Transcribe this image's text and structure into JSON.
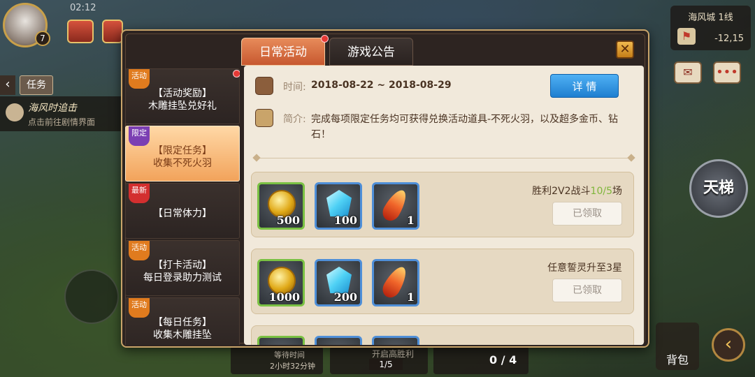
{
  "hud": {
    "level": "7",
    "status_time": "02:12",
    "task_tab": "任务",
    "task_title": "海风时追击",
    "task_hint": "点击前往剧情界面",
    "city_name": "海风城 1线",
    "coords": "-12,15",
    "ladder_label": "天梯",
    "bag_label": "背包",
    "wait_label": "等待时间",
    "wait_value": "2小时32分钟",
    "victory_label": "开启高胜利",
    "victory_count": "1/5",
    "match_count": "0 / 4"
  },
  "tabs": [
    {
      "label": "日常活动",
      "active": true
    },
    {
      "label": "游戏公告",
      "active": false
    }
  ],
  "side_list": [
    {
      "badge": "活动",
      "badge_color": "#e07b1e",
      "line1": "【活动奖励】",
      "line2": "木雕挂坠兑好礼",
      "active": false
    },
    {
      "badge": "限定",
      "badge_color": "#7b3fb3",
      "line1": "【限定任务】",
      "line2": "收集不死火羽",
      "active": true
    },
    {
      "badge": "最新",
      "badge_color": "#d32f2f",
      "line1": "【日常体力】",
      "line2": "",
      "active": false
    },
    {
      "badge": "活动",
      "badge_color": "#e07b1e",
      "line1": "【打卡活动】",
      "line2": "每日登录助力测试",
      "active": false
    },
    {
      "badge": "活动",
      "badge_color": "#e07b1e",
      "line1": "【每日任务】",
      "line2": "收集木雕挂坠",
      "active": false
    }
  ],
  "content": {
    "time_label": "时间:",
    "time_value": "2018-08-22 ~ 2018-08-29",
    "detail_button": "详 情",
    "intro_label": "简介:",
    "intro_text": "完成每项限定任务均可获得兑换活动道具-不死火羽，以及超多金币、钻石！",
    "tasks": [
      {
        "name_prefix": "胜利2V2战斗",
        "progress_current": "10",
        "progress_total": "/5",
        "name_suffix": "场",
        "rewards": [
          {
            "icon": "gold-coin-icon",
            "qty": "500"
          },
          {
            "icon": "diamond-icon",
            "qty": "100"
          },
          {
            "icon": "phoenix-feather-icon",
            "qty": "1"
          }
        ],
        "button": "已领取"
      },
      {
        "name_prefix": "任意誓灵升至3星",
        "progress_current": "",
        "progress_total": "",
        "name_suffix": "",
        "rewards": [
          {
            "icon": "gold-coin-icon",
            "qty": "1000"
          },
          {
            "icon": "diamond-icon",
            "qty": "200"
          },
          {
            "icon": "phoenix-feather-icon",
            "qty": "1"
          }
        ],
        "button": "已领取"
      }
    ]
  },
  "colors": {
    "accent_tab": "#e07a47",
    "detail_button": "#2f94e4",
    "progress_green": "#7fb63b"
  }
}
